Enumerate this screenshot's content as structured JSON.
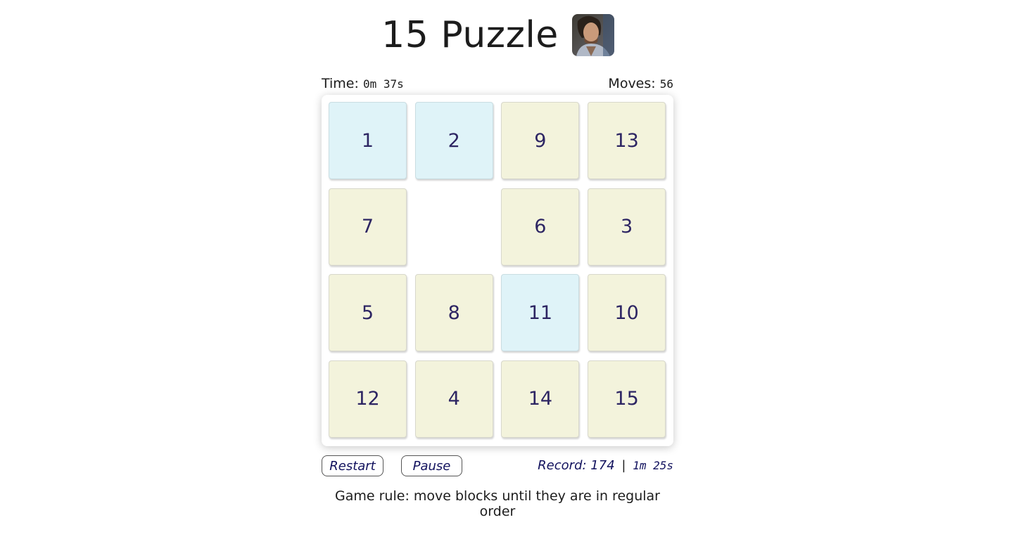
{
  "header": {
    "title": "15 Puzzle",
    "avatar_icon": "profile-photo-icon"
  },
  "stats": {
    "time_label": "Time:",
    "time_value": "0m 37s",
    "moves_label": "Moves:",
    "moves_value": "56"
  },
  "board": {
    "rows": [
      [
        "1",
        "2",
        "9",
        "13"
      ],
      [
        "7",
        "",
        "6",
        "3"
      ],
      [
        "5",
        "8",
        "11",
        "10"
      ],
      [
        "12",
        "4",
        "14",
        "15"
      ]
    ],
    "colors": {
      "correct_tile": "#dff3f8",
      "wrong_tile": "#f3f3dc",
      "number": "#2d2563"
    }
  },
  "controls": {
    "restart_label": "Restart",
    "pause_label": "Pause",
    "record_label": "Record:",
    "record_moves": "174",
    "record_separator": "|",
    "record_time": "1m 25s"
  },
  "footer": {
    "rule": "Game rule: move blocks until they are in regular order"
  }
}
